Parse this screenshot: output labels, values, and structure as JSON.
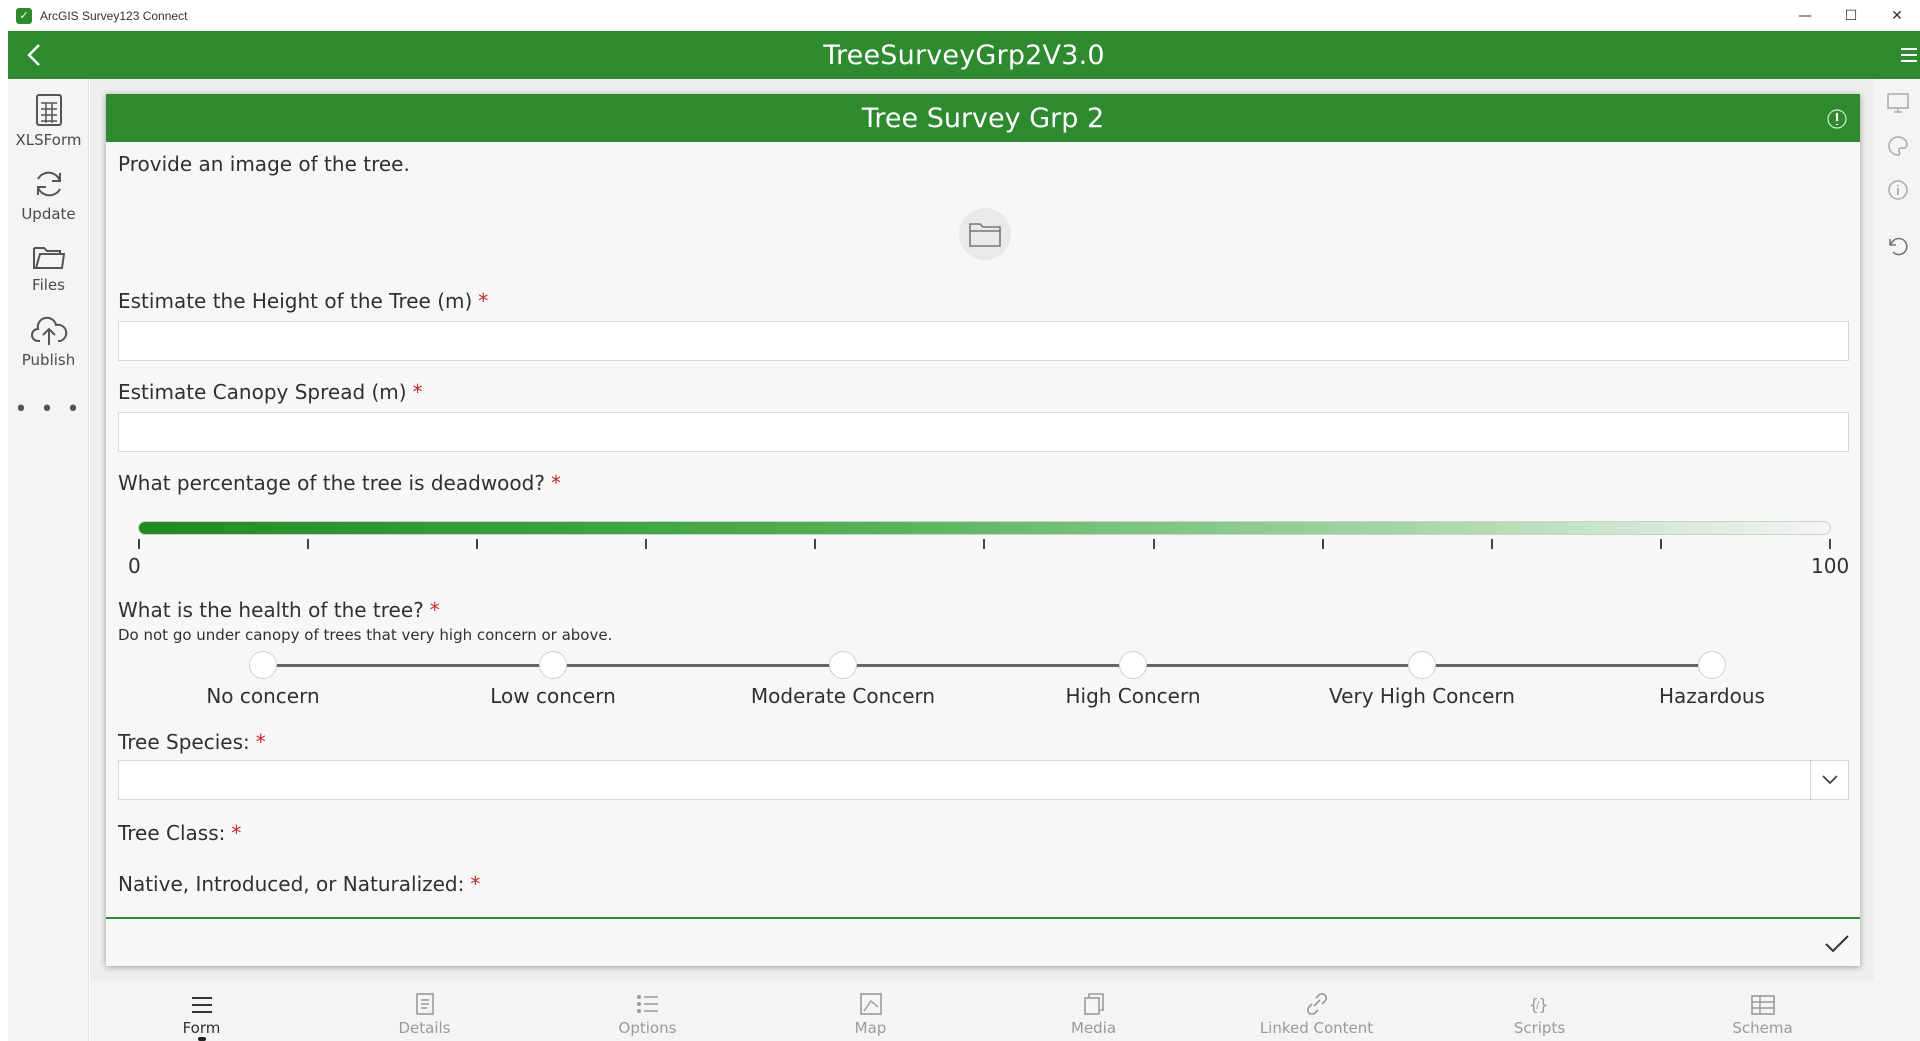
{
  "window": {
    "title": "ArcGIS Survey123 Connect",
    "controls": [
      "—",
      "☐",
      "✕"
    ]
  },
  "header": {
    "title": "TreeSurveyGrp2V3.0"
  },
  "left_sidebar": {
    "items": [
      {
        "label": "XLSForm",
        "icon": "spreadsheet-icon"
      },
      {
        "label": "Update",
        "icon": "refresh-icon"
      },
      {
        "label": "Files",
        "icon": "folder-icon"
      },
      {
        "label": "Publish",
        "icon": "cloud-upload-icon"
      }
    ],
    "more": "• • •"
  },
  "form": {
    "title": "Tree Survey Grp 2",
    "questions": {
      "image": {
        "label": "Provide an image of the tree."
      },
      "height": {
        "label": "Estimate the Height of the Tree (m)",
        "required": "*",
        "value": ""
      },
      "canopy": {
        "label": "Estimate Canopy Spread (m)",
        "required": "*",
        "value": ""
      },
      "deadwood": {
        "label": "What percentage of the tree is deadwood?",
        "required": "*",
        "min": "0",
        "max": "100"
      },
      "health": {
        "label": "What is the health of the tree?",
        "required": "*",
        "hint": "Do not go under canopy of trees that very high concern or above.",
        "options": [
          "No concern",
          "Low concern",
          "Moderate Concern",
          "High Concern",
          "Very High Concern",
          "Hazardous"
        ]
      },
      "species": {
        "label": "Tree Species:",
        "required": "*",
        "value": ""
      },
      "class": {
        "label": "Tree Class:",
        "required": "*"
      },
      "native": {
        "label": "Native, Introduced, or Naturalized:",
        "required": "*"
      }
    }
  },
  "bottom_tabs": [
    {
      "label": "Form",
      "icon": "form-icon",
      "active": true
    },
    {
      "label": "Details",
      "icon": "details-icon",
      "active": false
    },
    {
      "label": "Options",
      "icon": "options-icon",
      "active": false
    },
    {
      "label": "Map",
      "icon": "map-icon",
      "active": false
    },
    {
      "label": "Media",
      "icon": "media-icon",
      "active": false
    },
    {
      "label": "Linked Content",
      "icon": "link-icon",
      "active": false
    },
    {
      "label": "Scripts",
      "icon": "scripts-icon",
      "active": false
    },
    {
      "label": "Schema",
      "icon": "schema-icon",
      "active": false
    }
  ],
  "colors": {
    "brand_green": "#2e8a2f",
    "required_red": "#c62828"
  }
}
